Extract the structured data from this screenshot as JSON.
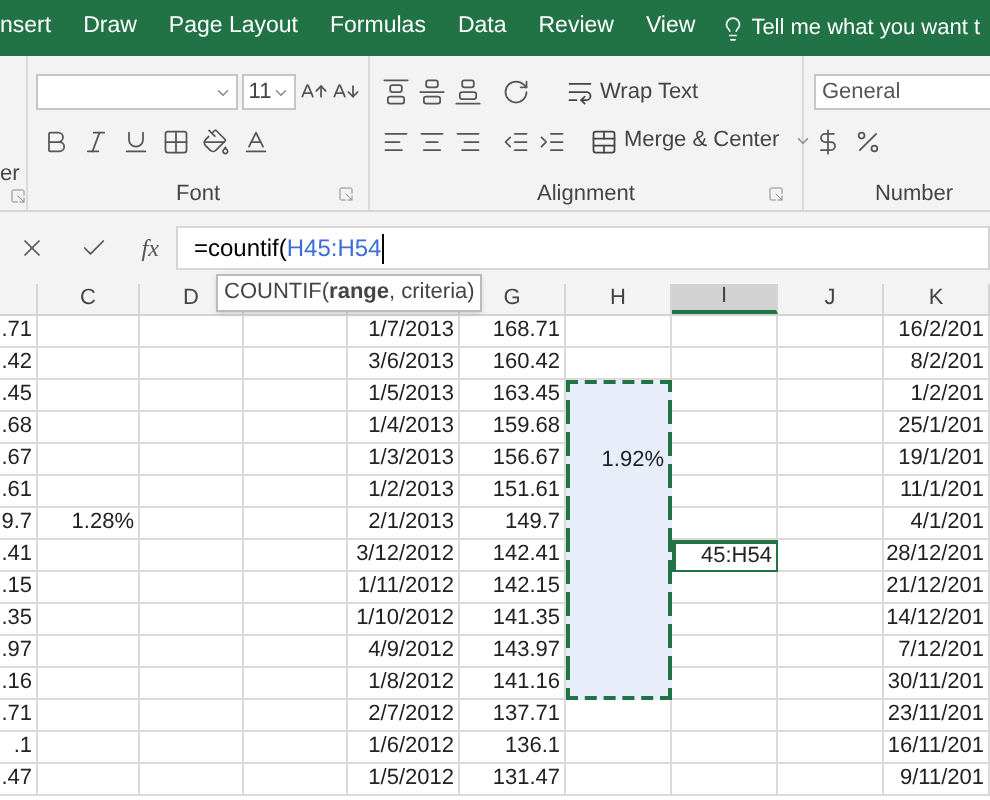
{
  "ribbon_tabs": [
    {
      "label": "nsert",
      "selected": false
    },
    {
      "label": "Draw",
      "selected": false
    },
    {
      "label": "Page Layout",
      "selected": false
    },
    {
      "label": "Formulas",
      "selected": false
    },
    {
      "label": "Data",
      "selected": false
    },
    {
      "label": "Review",
      "selected": false
    },
    {
      "label": "View",
      "selected": false
    }
  ],
  "tell_me": "Tell me what you want t",
  "ribbon": {
    "clipboard_label": "er",
    "font_size": "11",
    "font_group": "Font",
    "wrap_text": "Wrap Text",
    "merge_center": "Merge & Center",
    "alignment_group": "Alignment",
    "number_format": "General",
    "number_group": "Number"
  },
  "formula_bar": {
    "fx": "fx",
    "prefix": "=countif(",
    "reference": "H45:H54",
    "tooltip": "COUNTIF(**range**, criteria)"
  },
  "columns": [
    {
      "selected": false
    },
    {
      "label": "C",
      "selected": false
    },
    {
      "label": "D",
      "selected": false
    },
    {
      "selected": false
    },
    {
      "selected": false
    },
    {
      "label": "G",
      "selected": false
    },
    {
      "label": "H",
      "selected": false
    },
    {
      "label": "I",
      "selected": true
    },
    {
      "label": "J",
      "selected": false
    },
    {
      "label": "K",
      "selected": false
    }
  ],
  "rows": [
    {
      "cells": [
        ".71",
        null,
        null,
        null,
        "1/7/2013",
        "168.71",
        null,
        null,
        null,
        "16/2/201"
      ],
      "in_range": false,
      "active": false
    },
    {
      "cells": [
        ".42",
        null,
        null,
        null,
        "3/6/2013",
        "160.42",
        null,
        null,
        null,
        "8/2/201"
      ],
      "in_range": false,
      "active": false
    },
    {
      "cells": [
        ".45",
        null,
        null,
        null,
        "1/5/2013",
        "163.45",
        null,
        null,
        null,
        "1/2/201"
      ],
      "in_range": true,
      "active": false
    },
    {
      "cells": [
        ".68",
        null,
        null,
        null,
        "1/4/2013",
        "159.68",
        null,
        null,
        null,
        "25/1/201"
      ],
      "in_range": true,
      "active": false
    },
    {
      "cells": [
        ".67",
        null,
        null,
        null,
        "1/3/2013",
        "156.67",
        "1.92%",
        null,
        null,
        "19/1/201"
      ],
      "in_range": true,
      "active": false
    },
    {
      "cells": [
        ".61",
        null,
        null,
        null,
        "1/2/2013",
        "151.61",
        null,
        null,
        null,
        "11/1/201"
      ],
      "in_range": true,
      "active": false
    },
    {
      "cells": [
        "9.7",
        "1.28%",
        null,
        null,
        "2/1/2013",
        "149.7",
        null,
        null,
        null,
        "4/1/201"
      ],
      "in_range": true,
      "active": false
    },
    {
      "cells": [
        ".41",
        null,
        null,
        null,
        "3/12/2012",
        "142.41",
        null,
        "45:H54",
        null,
        "28/12/201"
      ],
      "in_range": true,
      "active": true
    },
    {
      "cells": [
        ".15",
        null,
        null,
        null,
        "1/11/2012",
        "142.15",
        null,
        null,
        null,
        "21/12/201"
      ],
      "in_range": true,
      "active": false
    },
    {
      "cells": [
        ".35",
        null,
        null,
        null,
        "1/10/2012",
        "141.35",
        null,
        null,
        null,
        "14/12/201"
      ],
      "in_range": true,
      "active": false
    },
    {
      "cells": [
        ".97",
        null,
        null,
        null,
        "4/9/2012",
        "143.97",
        null,
        null,
        null,
        "7/12/201"
      ],
      "in_range": true,
      "active": false
    },
    {
      "cells": [
        ".16",
        null,
        null,
        null,
        "1/8/2012",
        "141.16",
        null,
        null,
        null,
        "30/11/201"
      ],
      "in_range": true,
      "active": false
    },
    {
      "cells": [
        ".71",
        null,
        null,
        null,
        "2/7/2012",
        "137.71",
        null,
        null,
        null,
        "23/11/201"
      ],
      "in_range": false,
      "active": false
    },
    {
      "cells": [
        ".1",
        null,
        null,
        null,
        "1/6/2012",
        "136.1",
        null,
        null,
        null,
        "16/11/201"
      ],
      "in_range": false,
      "active": false
    },
    {
      "cells": [
        ".47",
        null,
        null,
        null,
        "1/5/2012",
        "131.47",
        null,
        null,
        null,
        "9/11/201"
      ],
      "in_range": false,
      "active": false
    }
  ]
}
